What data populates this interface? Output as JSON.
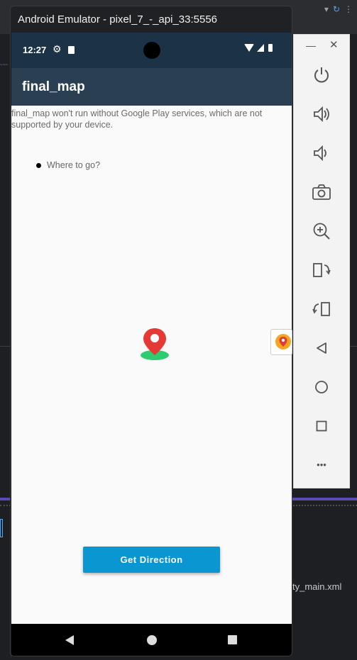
{
  "emulator": {
    "title": "Android Emulator - pixel_7_-_api_33:5556"
  },
  "status_bar": {
    "time": "12:27"
  },
  "app": {
    "title": "final_map",
    "gps_message": "final_map won't run without Google Play services, which are not supported by your device.",
    "destination_placeholder": "Where to go?",
    "get_direction_label": "Get Direction"
  },
  "ide": {
    "file_tab": "ty_main.xml"
  },
  "controls": {
    "minimize_label": "—",
    "close_label": "✕",
    "more_label": "•••"
  },
  "colors": {
    "app_bar": "#2b3f52",
    "status_bar": "#1c3347",
    "button": "#0a96d1",
    "pin_red": "#e53935",
    "pin_base": "#2ecc71"
  }
}
